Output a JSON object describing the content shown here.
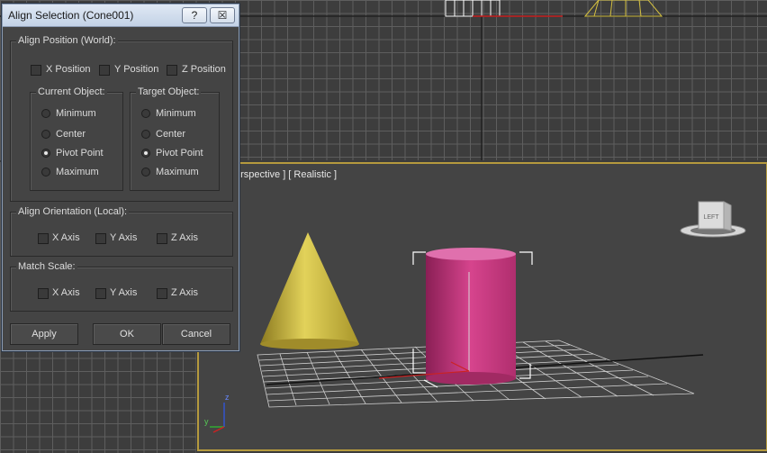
{
  "dialog": {
    "title": "Align Selection (Cone001)",
    "help_label": "?",
    "close_label": "☒",
    "align_position": {
      "label": "Align Position (World):",
      "x": {
        "label": "X Position",
        "checked": false
      },
      "y": {
        "label": "Y Position",
        "checked": false
      },
      "z": {
        "label": "Z Position",
        "checked": false
      }
    },
    "current_object": {
      "label": "Current Object:",
      "options": [
        "Minimum",
        "Center",
        "Pivot Point",
        "Maximum"
      ],
      "selected": "Pivot Point"
    },
    "target_object": {
      "label": "Target Object:",
      "options": [
        "Minimum",
        "Center",
        "Pivot Point",
        "Maximum"
      ],
      "selected": "Pivot Point"
    },
    "align_orientation": {
      "label": "Align Orientation (Local):",
      "x": "X Axis",
      "y": "Y Axis",
      "z": "Z Axis"
    },
    "match_scale": {
      "label": "Match Scale:",
      "x": "X Axis",
      "y": "Y Axis",
      "z": "Z Axis"
    },
    "buttons": {
      "apply": "Apply",
      "ok": "OK",
      "cancel": "Cancel"
    }
  },
  "viewport": {
    "label": "erspective ] [ Realistic ]",
    "viewcube_face": "LEFT",
    "axis_z": "z",
    "axis_y": "y"
  },
  "colors": {
    "active_border": "#b59a3e",
    "cone": "#d4c040",
    "cylinder": "#c83a80",
    "dialog_title": "#c3d2e6"
  }
}
